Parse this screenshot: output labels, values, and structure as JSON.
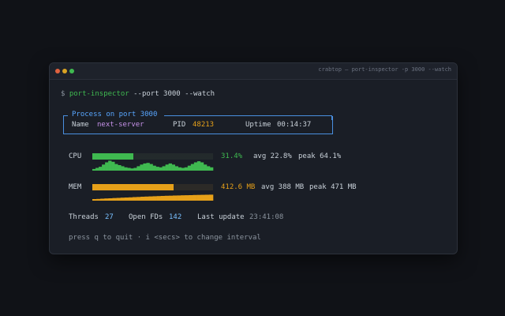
{
  "window": {
    "title": "crabtop — port-inspector -p 3000 --watch"
  },
  "command": {
    "prompt": "$",
    "program": "port-inspector",
    "args": "--port 3000 --watch"
  },
  "process": {
    "box_title": "Process on port 3000",
    "name_label": "Name",
    "name_value": "next-server",
    "pid_label": "PID",
    "pid_value": "48213",
    "uptime_label": "Uptime",
    "uptime_value": "00:14:37"
  },
  "cpu": {
    "label": "CPU",
    "percent_text": "31.4%",
    "avg_text": "avg 22.8%",
    "peak_text": "peak 64.1%",
    "fill_fraction": 0.34,
    "color": "#3fb950",
    "sparkline": [
      0.15,
      0.25,
      0.35,
      0.55,
      0.75,
      0.9,
      0.8,
      0.6,
      0.5,
      0.4,
      0.3,
      0.25,
      0.2,
      0.25,
      0.4,
      0.55,
      0.65,
      0.7,
      0.6,
      0.45,
      0.35,
      0.3,
      0.4,
      0.55,
      0.65,
      0.55,
      0.4,
      0.3,
      0.25,
      0.3,
      0.45,
      0.6,
      0.75,
      0.85,
      0.75,
      0.55,
      0.4,
      0.3
    ]
  },
  "mem": {
    "label": "MEM",
    "value_text": "412.6 MB",
    "avg_text": "avg 388 MB",
    "peak_text": "peak 471 MB",
    "fill_fraction": 0.67,
    "color": "#e6a019",
    "sparkline": [
      0.2,
      0.22,
      0.25,
      0.28,
      0.3,
      0.33,
      0.35,
      0.38,
      0.4,
      0.42,
      0.45,
      0.47,
      0.5,
      0.52,
      0.54,
      0.56,
      0.58,
      0.6,
      0.62,
      0.63,
      0.65,
      0.66,
      0.68,
      0.69,
      0.7,
      0.72,
      0.73,
      0.74,
      0.75,
      0.76
    ]
  },
  "stats": {
    "threads_label": "Threads",
    "threads_value": "27",
    "fds_label": "Open FDs",
    "fds_value": "142",
    "update_label": "Last update",
    "update_value": "23:41:08"
  },
  "footer": {
    "hint": "press q to quit · i <secs> to change interval"
  }
}
